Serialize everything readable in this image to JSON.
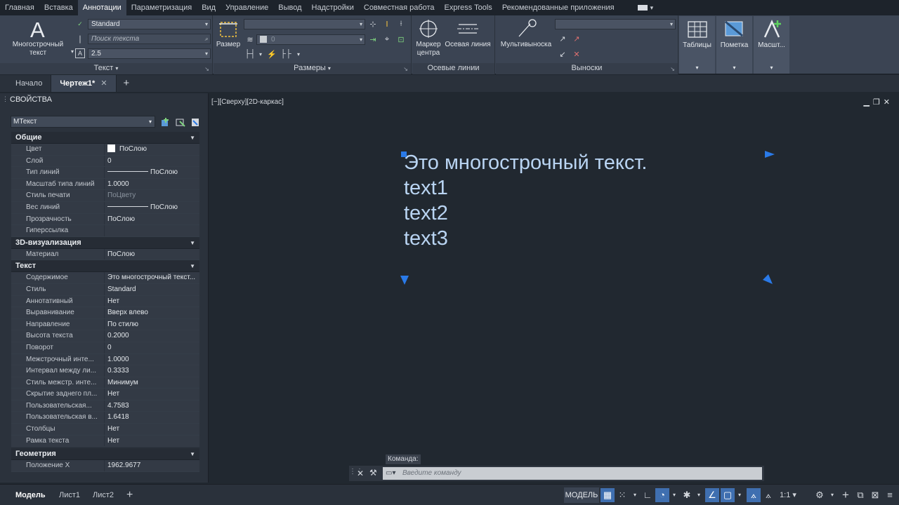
{
  "menu": {
    "items": [
      "Главная",
      "Вставка",
      "Аннотации",
      "Параметризация",
      "Вид",
      "Управление",
      "Вывод",
      "Надстройки",
      "Совместная работа",
      "Express Tools",
      "Рекомендованные приложения"
    ],
    "active_index": 2
  },
  "ribbon": {
    "text_panel": {
      "mtext_label_line1": "Многострочный",
      "mtext_label_line2": "текст",
      "style_value": "Standard",
      "search_placeholder": "Поиск текста",
      "height_value": "2.5",
      "title": "Текст"
    },
    "dim_panel": {
      "dim_label": "Размер",
      "layer_value": "0",
      "title": "Размеры"
    },
    "center_panel": {
      "marker_label_line1": "Маркер",
      "marker_label_line2": "центра",
      "centerline_label": "Осевая линия",
      "title": "Осевые линии"
    },
    "leader_panel": {
      "mleader_label": "Мультивыноска",
      "title": "Выноски"
    },
    "tables_label": "Таблицы",
    "markup_label": "Пометка",
    "scale_label": "Масшт..."
  },
  "file_tabs": {
    "start": "Начало",
    "drawing": "Чертеж1*"
  },
  "properties": {
    "title": "СВОЙСТВА",
    "object_type": "МТекст",
    "sections": [
      {
        "name": "Общие",
        "rows": [
          {
            "key": "Цвет",
            "value": "ПоСлою",
            "kind": "swatch"
          },
          {
            "key": "Слой",
            "value": "0"
          },
          {
            "key": "Тип линий",
            "value": "ПоСлою",
            "kind": "line"
          },
          {
            "key": "Масштаб типа линий",
            "value": "1.0000"
          },
          {
            "key": "Стиль печати",
            "value": "ПоЦвету",
            "kind": "dim"
          },
          {
            "key": "Вес линий",
            "value": "ПоСлою",
            "kind": "line"
          },
          {
            "key": "Прозрачность",
            "value": "ПоСлою"
          },
          {
            "key": "Гиперссылка",
            "value": ""
          }
        ]
      },
      {
        "name": "3D-визуализация",
        "rows": [
          {
            "key": "Материал",
            "value": "ПоСлою"
          }
        ]
      },
      {
        "name": "Текст",
        "rows": [
          {
            "key": "Содержимое",
            "value": "Это многострочный текст..."
          },
          {
            "key": "Стиль",
            "value": "Standard"
          },
          {
            "key": "Аннотативный",
            "value": "Нет"
          },
          {
            "key": "Выравнивание",
            "value": "Вверх влево"
          },
          {
            "key": "Направление",
            "value": "По стилю"
          },
          {
            "key": "Высота текста",
            "value": "0.2000"
          },
          {
            "key": "Поворот",
            "value": "0"
          },
          {
            "key": "Межстрочный инте...",
            "value": "1.0000"
          },
          {
            "key": "Интервал между ли...",
            "value": "0.3333"
          },
          {
            "key": "Стиль межстр. инте...",
            "value": "Минимум"
          },
          {
            "key": "Скрытие заднего пл...",
            "value": "Нет"
          },
          {
            "key": "Пользовательская...",
            "value": "4.7583"
          },
          {
            "key": "Пользовательская в...",
            "value": "1.6418"
          },
          {
            "key": "Столбцы",
            "value": "Нет"
          },
          {
            "key": "Рамка текста",
            "value": "Нет"
          }
        ]
      },
      {
        "name": "Геометрия",
        "rows": [
          {
            "key": "Положение X",
            "value": "1962.9677"
          }
        ]
      }
    ]
  },
  "viewport": {
    "label": "[−][Сверху][2D-каркас]",
    "mtext_lines": [
      "Это многострочный текст.",
      "text1",
      "text2",
      "text3"
    ]
  },
  "command": {
    "label": "Команда:",
    "placeholder": "Введите команду"
  },
  "layout_tabs": [
    "Модель",
    "Лист1",
    "Лист2"
  ],
  "status": {
    "model": "МОДЕЛЬ",
    "scale": "1:1"
  },
  "colors": {
    "grip": "#2a7ae8",
    "mtext": "#b9d4f2",
    "accent": "#3f6fb0"
  }
}
